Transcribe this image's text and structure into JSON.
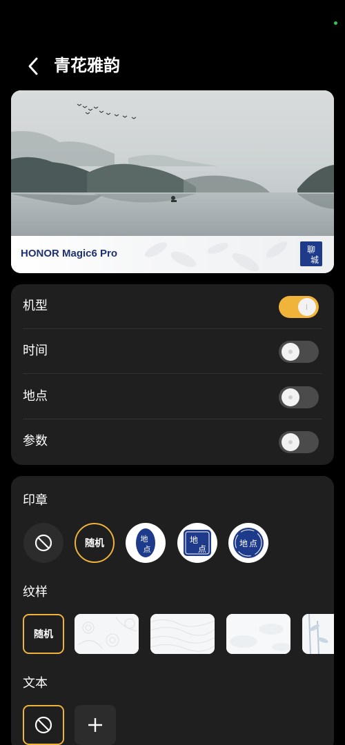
{
  "header": {
    "title": "青花雅韵"
  },
  "preview": {
    "device_caption": "HONOR Magic6 Pro",
    "seal_text": "聊城"
  },
  "toggles": [
    {
      "label": "机型",
      "on": true
    },
    {
      "label": "时间",
      "on": false
    },
    {
      "label": "地点",
      "on": false
    },
    {
      "label": "参数",
      "on": false
    }
  ],
  "seal_section": {
    "title": "印章",
    "options": [
      {
        "icon": "ban-icon"
      },
      {
        "label": "随机",
        "selected": true
      },
      {
        "seal_text": "地点",
        "style": "oval-seal"
      },
      {
        "seal_text": "地点",
        "style": "square-seal"
      },
      {
        "seal_text": "地点",
        "style": "round-seal"
      }
    ]
  },
  "pattern_section": {
    "title": "纹样",
    "options": [
      {
        "label": "随机",
        "selected": true
      },
      {
        "style": "floral-pattern"
      },
      {
        "style": "wave-line-pattern"
      },
      {
        "style": "cloud-pattern"
      },
      {
        "style": "bamboo-pattern"
      }
    ]
  },
  "text_section": {
    "title": "文本",
    "options": [
      {
        "icon": "ban-icon",
        "selected": true
      },
      {
        "icon": "plus-icon"
      }
    ]
  },
  "colors": {
    "accent": "#f0b43a",
    "card": "#1f1f1f",
    "seal_blue": "#1e3a8a",
    "caption_blue": "#1f3170"
  }
}
